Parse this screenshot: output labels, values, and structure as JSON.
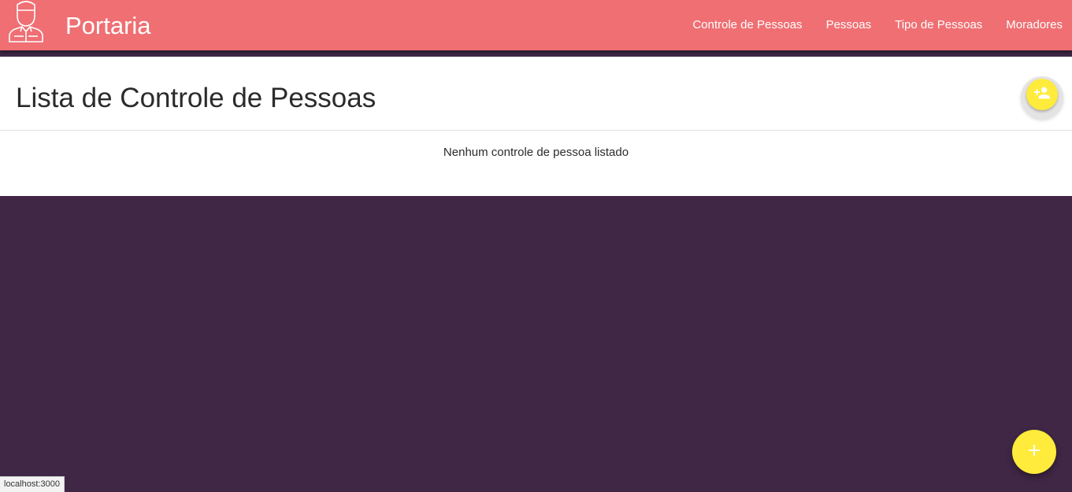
{
  "navbar": {
    "brand": "Portaria",
    "links": [
      "Controle de Pessoas",
      "Pessoas",
      "Tipo de Pessoas",
      "Moradores"
    ],
    "logo_icon": "doorman-icon"
  },
  "card": {
    "title": "Lista de Controle de Pessoas",
    "empty_message": "Nenhum controle de pessoa listado",
    "add_button_icon": "person-add-icon"
  },
  "fab": {
    "icon": "plus-icon"
  },
  "status_bar": {
    "url": "localhost:3000"
  },
  "colors": {
    "navbar": "#ef6f73",
    "background": "#3f2745",
    "accent": "#ffeb3b"
  }
}
